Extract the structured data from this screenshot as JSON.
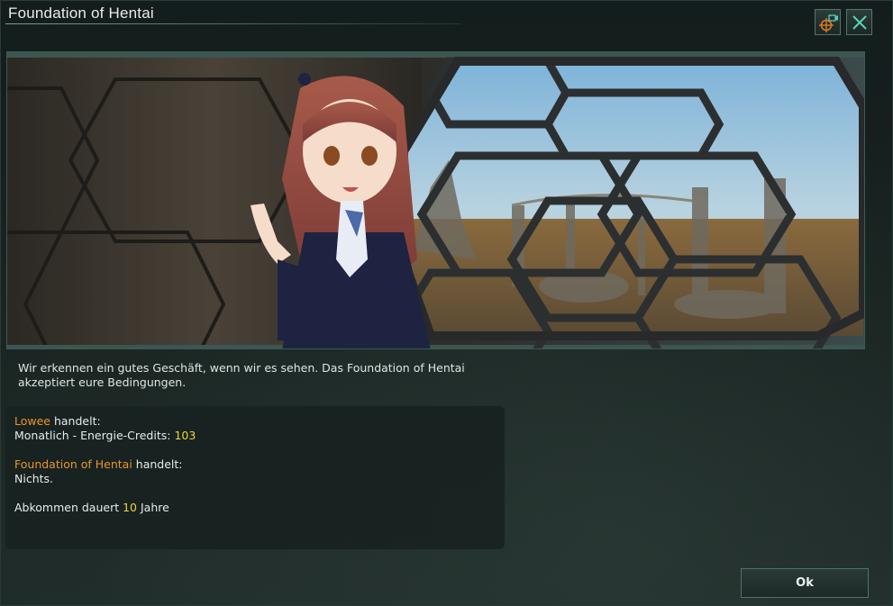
{
  "window": {
    "title": "Foundation of Hentai"
  },
  "header_buttons": {
    "camera_icon": "camera-locate-icon",
    "close_icon": "close-icon"
  },
  "message": "Wir erkennen ein gutes Geschäft, wenn wir es sehen. Das Foundation of Hentai akzeptiert eure Bedingungen.",
  "deal": {
    "party1_name": "Lowee",
    "party1_suffix": " handelt:",
    "party1_item_label": "Monatlich - Energie-Credits: ",
    "party1_item_value": "103",
    "party2_name": "Foundation of Hentai",
    "party2_suffix": " handelt:",
    "party2_item": "Nichts.",
    "duration_prefix": "Abkommen dauert ",
    "duration_value": "10",
    "duration_suffix": " Jahre"
  },
  "ok_button": {
    "label": "Ok"
  },
  "colors": {
    "accent_orange": "#e8962a",
    "accent_yellow": "#e9d63a",
    "frame_teal": "#6aa49a"
  }
}
